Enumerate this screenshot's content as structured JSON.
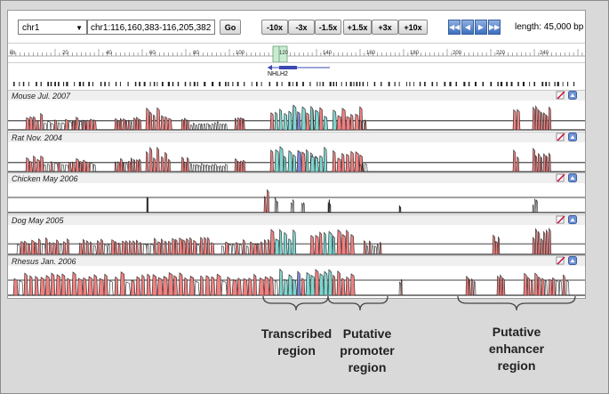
{
  "toolbar": {
    "chromosome": "chr1",
    "location": "chr1:116,160,383-116,205,382",
    "go_label": "Go",
    "zoom_buttons": [
      "-10x",
      "-3x",
      "-1.5x",
      "+1.5x",
      "+3x",
      "+10x"
    ],
    "length_text": "length: 45,000 bp"
  },
  "ruler": {
    "unit": "kb",
    "ticks": [
      "20",
      "40",
      "60",
      "80",
      "100",
      "120",
      "140",
      "160",
      "180",
      "200",
      "220",
      "240"
    ]
  },
  "gene": {
    "name": "NHLH2"
  },
  "tracks": [
    {
      "name": "Mouse Jul. 2007"
    },
    {
      "name": "Rat Nov. 2004"
    },
    {
      "name": "Chicken May 2006"
    },
    {
      "name": "Dog May 2005"
    },
    {
      "name": "Rhesus Jan. 2006"
    }
  ],
  "regions": [
    {
      "label": "Transcribed region"
    },
    {
      "label": "Putative promoter region"
    },
    {
      "label": "Putative enhancer region"
    }
  ],
  "colors": {
    "conserved_noncoding": "#f08080",
    "conserved_utr": "#7fd6cf",
    "conserved_exon": "#7b86d6"
  }
}
